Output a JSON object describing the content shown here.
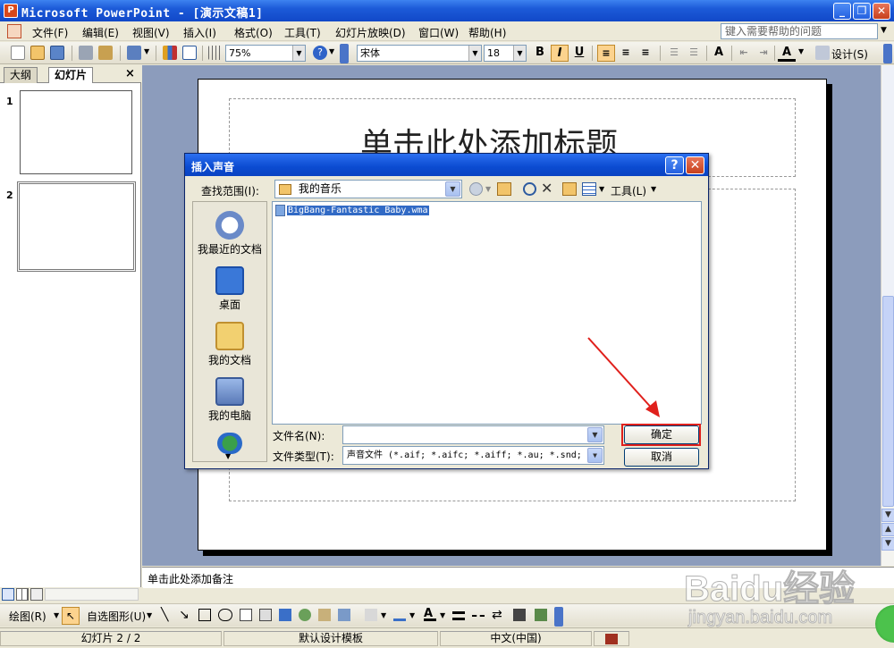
{
  "window": {
    "title": "Microsoft PowerPoint - [演示文稿1]",
    "minimize": "_",
    "restore": "❐",
    "close": "✕"
  },
  "menu": {
    "items": [
      "文件(F)",
      "编辑(E)",
      "视图(V)",
      "插入(I)",
      "格式(O)",
      "工具(T)",
      "幻灯片放映(D)",
      "窗口(W)",
      "帮助(H)"
    ],
    "help_placeholder": "键入需要帮助的问题"
  },
  "toolbar": {
    "zoom": "75%",
    "font": "宋体",
    "font_size": "18",
    "bold": "B",
    "italic": "I",
    "underline": "U",
    "design_label": "设计(S)"
  },
  "left_pane": {
    "tab_outline": "大纲",
    "tab_slides": "幻灯片",
    "close": "×",
    "slides": [
      {
        "num": "1"
      },
      {
        "num": "2"
      }
    ]
  },
  "slide": {
    "title_placeholder": "单击此处添加标题"
  },
  "notes": {
    "placeholder": "单击此处添加备注"
  },
  "drawing_toolbar": {
    "draw_label": "绘图(R)",
    "autoshapes_label": "自选图形(U)"
  },
  "status": {
    "slide_pos": "幻灯片 2 / 2",
    "template": "默认设计模板",
    "language": "中文(中国)"
  },
  "dialog": {
    "title": "插入声音",
    "help": "?",
    "close": "✕",
    "look_in_label": "查找范围(I):",
    "look_in_value": "我的音乐",
    "tools_label": "工具(L)",
    "places": [
      "我最近的文档",
      "桌面",
      "我的文档",
      "我的电脑"
    ],
    "files": [
      {
        "name": "BigBang-Fantastic Baby.wma"
      }
    ],
    "filename_label": "文件名(N):",
    "filename_value": "",
    "filetype_label": "文件类型(T):",
    "filetype_value": "声音文件 (*.aif; *.aifc; *.aiff; *.au; *.snd; *",
    "ok_button": "确定",
    "cancel_button": "取消"
  },
  "watermark": {
    "brand": "Baidu经验",
    "url": "jingyan.baidu.com"
  },
  "colors": {
    "xp_blue": "#0b4bd1",
    "highlight_red": "#e0201c",
    "selection": "#316ac5"
  }
}
